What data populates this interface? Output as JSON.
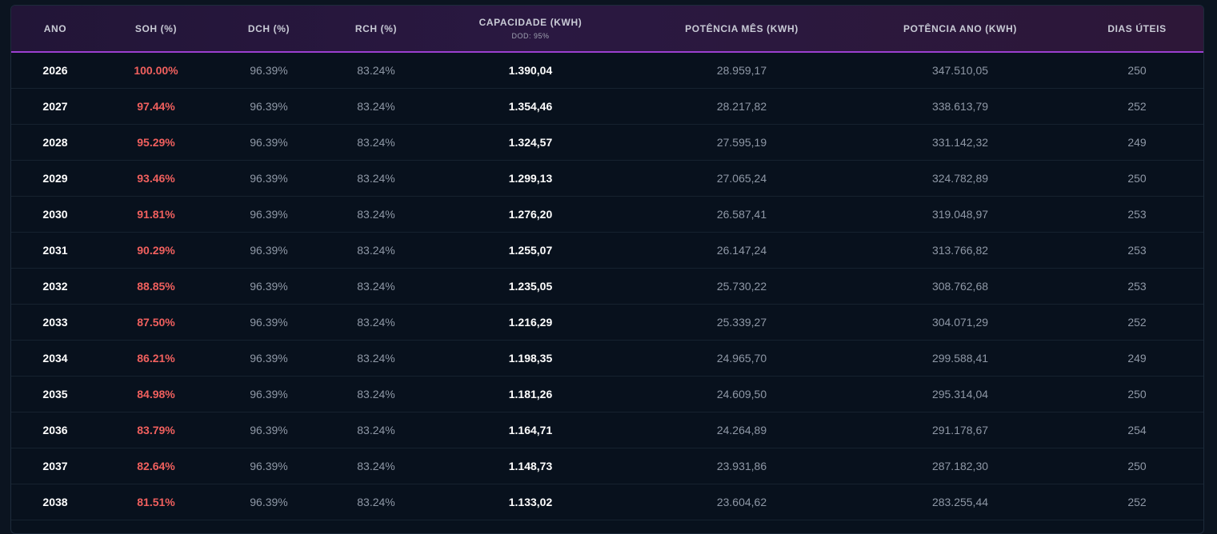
{
  "table": {
    "headers": {
      "ano": "ANO",
      "soh": "SOH (%)",
      "dch": "DCH (%)",
      "rch": "RCH (%)",
      "capacidade": "CAPACIDADE (KWH)",
      "capacidade_sub": "DOD: 95%",
      "potencia_mes": "POTÊNCIA MÊS (KWH)",
      "potencia_ano": "POTÊNCIA ANO (KWH)",
      "dias_uteis": "DIAS ÚTEIS"
    },
    "rows": [
      {
        "ano": "2026",
        "soh": "100.00%",
        "dch": "96.39%",
        "rch": "83.24%",
        "capacidade": "1.390,04",
        "potencia_mes": "28.959,17",
        "potencia_ano": "347.510,05",
        "dias_uteis": "250"
      },
      {
        "ano": "2027",
        "soh": "97.44%",
        "dch": "96.39%",
        "rch": "83.24%",
        "capacidade": "1.354,46",
        "potencia_mes": "28.217,82",
        "potencia_ano": "338.613,79",
        "dias_uteis": "252"
      },
      {
        "ano": "2028",
        "soh": "95.29%",
        "dch": "96.39%",
        "rch": "83.24%",
        "capacidade": "1.324,57",
        "potencia_mes": "27.595,19",
        "potencia_ano": "331.142,32",
        "dias_uteis": "249"
      },
      {
        "ano": "2029",
        "soh": "93.46%",
        "dch": "96.39%",
        "rch": "83.24%",
        "capacidade": "1.299,13",
        "potencia_mes": "27.065,24",
        "potencia_ano": "324.782,89",
        "dias_uteis": "250"
      },
      {
        "ano": "2030",
        "soh": "91.81%",
        "dch": "96.39%",
        "rch": "83.24%",
        "capacidade": "1.276,20",
        "potencia_mes": "26.587,41",
        "potencia_ano": "319.048,97",
        "dias_uteis": "253"
      },
      {
        "ano": "2031",
        "soh": "90.29%",
        "dch": "96.39%",
        "rch": "83.24%",
        "capacidade": "1.255,07",
        "potencia_mes": "26.147,24",
        "potencia_ano": "313.766,82",
        "dias_uteis": "253"
      },
      {
        "ano": "2032",
        "soh": "88.85%",
        "dch": "96.39%",
        "rch": "83.24%",
        "capacidade": "1.235,05",
        "potencia_mes": "25.730,22",
        "potencia_ano": "308.762,68",
        "dias_uteis": "253"
      },
      {
        "ano": "2033",
        "soh": "87.50%",
        "dch": "96.39%",
        "rch": "83.24%",
        "capacidade": "1.216,29",
        "potencia_mes": "25.339,27",
        "potencia_ano": "304.071,29",
        "dias_uteis": "252"
      },
      {
        "ano": "2034",
        "soh": "86.21%",
        "dch": "96.39%",
        "rch": "83.24%",
        "capacidade": "1.198,35",
        "potencia_mes": "24.965,70",
        "potencia_ano": "299.588,41",
        "dias_uteis": "249"
      },
      {
        "ano": "2035",
        "soh": "84.98%",
        "dch": "96.39%",
        "rch": "83.24%",
        "capacidade": "1.181,26",
        "potencia_mes": "24.609,50",
        "potencia_ano": "295.314,04",
        "dias_uteis": "250"
      },
      {
        "ano": "2036",
        "soh": "83.79%",
        "dch": "96.39%",
        "rch": "83.24%",
        "capacidade": "1.164,71",
        "potencia_mes": "24.264,89",
        "potencia_ano": "291.178,67",
        "dias_uteis": "254"
      },
      {
        "ano": "2037",
        "soh": "82.64%",
        "dch": "96.39%",
        "rch": "83.24%",
        "capacidade": "1.148,73",
        "potencia_mes": "23.931,86",
        "potencia_ano": "287.182,30",
        "dias_uteis": "250"
      },
      {
        "ano": "2038",
        "soh": "81.51%",
        "dch": "96.39%",
        "rch": "83.24%",
        "capacidade": "1.133,02",
        "potencia_mes": "23.604,62",
        "potencia_ano": "283.255,44",
        "dias_uteis": "252"
      }
    ]
  }
}
